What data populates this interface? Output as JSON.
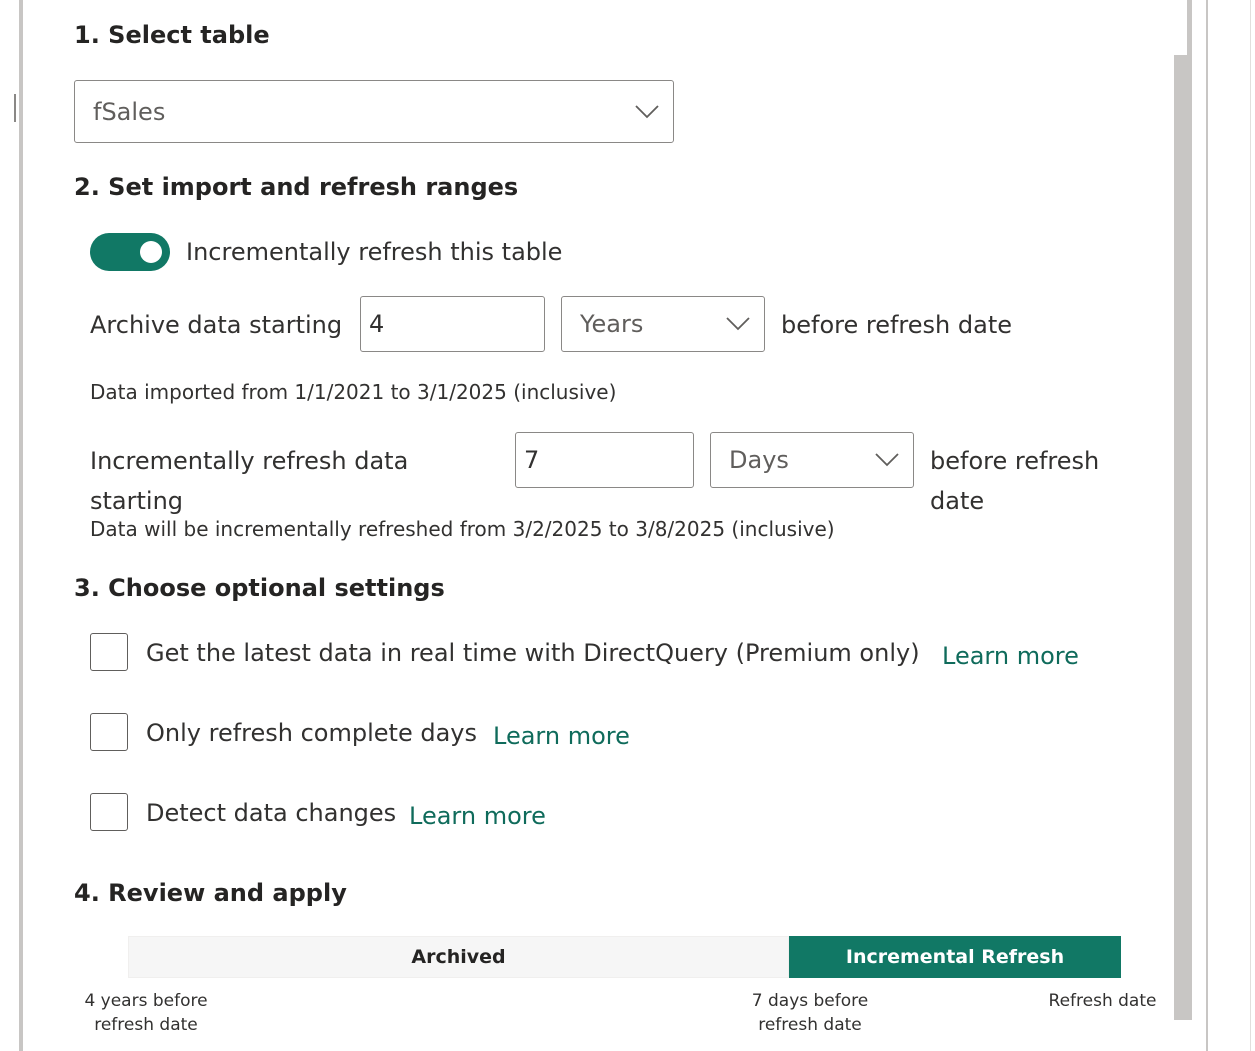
{
  "sections": {
    "s1": "1. Select table",
    "s2": "2. Set import and refresh ranges",
    "s3": "3. Choose optional settings",
    "s4": "4. Review and apply"
  },
  "table_select": {
    "value": "fSales"
  },
  "toggle": {
    "label": "Incrementally refresh this table",
    "on": true
  },
  "archive": {
    "label": "Archive data starting",
    "value": "4",
    "unit": "Years",
    "suffix": "before refresh date",
    "note": "Data imported from 1/1/2021 to 3/1/2025 (inclusive)"
  },
  "incremental": {
    "label_line1": "Incrementally refresh data",
    "label_line2": "starting",
    "value": "7",
    "unit": "Days",
    "suffix_line1": "before refresh",
    "suffix_line2": "date",
    "note": "Data will be incrementally refreshed from 3/2/2025 to 3/8/2025 (inclusive)"
  },
  "options": [
    {
      "label": "Get the latest data in real time with DirectQuery (Premium only)",
      "link": "Learn more",
      "checked": false
    },
    {
      "label": "Only refresh complete days",
      "link": "Learn more",
      "checked": false
    },
    {
      "label": "Detect data changes",
      "link": "Learn more",
      "checked": false
    }
  ],
  "timeline": {
    "archived_label": "Archived",
    "incremental_label": "Incremental Refresh",
    "left_line1": "4 years before",
    "left_line2": "refresh date",
    "mid_line1": "7 days before",
    "mid_line2": "refresh date",
    "right": "Refresh date"
  },
  "colors": {
    "accent": "#117865",
    "link": "#0f6b5b",
    "border": "#8a8886"
  }
}
